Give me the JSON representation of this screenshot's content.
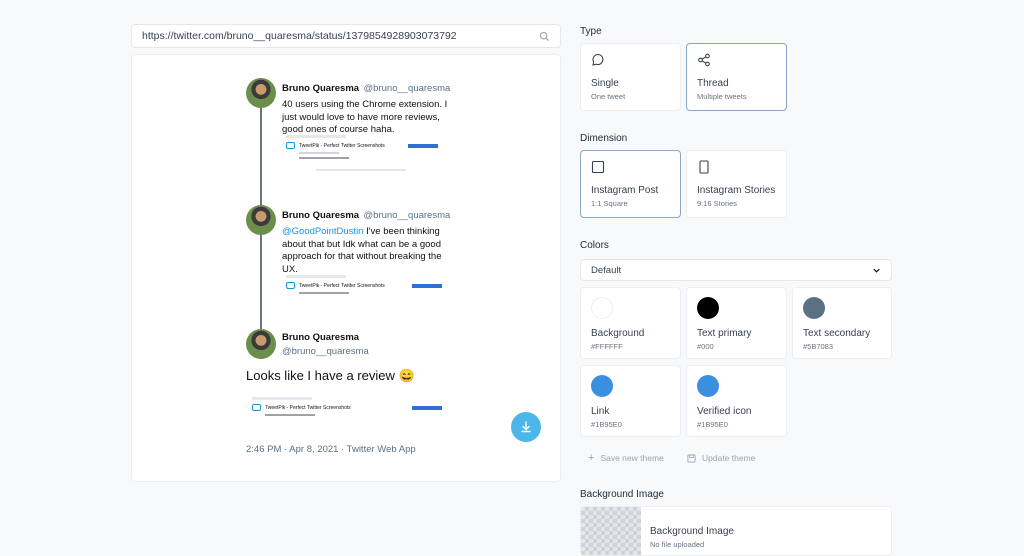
{
  "url_bar": {
    "value": "https://twitter.com/bruno__quaresma/status/1379854928903073792"
  },
  "tweets": [
    {
      "name": "Bruno Quaresma",
      "handle": "@bruno__quaresma",
      "body": "40 users using the Chrome extension. I just would love to have more reviews, good ones of course haha.",
      "mini_title": "TweetPik - Perfect Twitter Screenshots"
    },
    {
      "name": "Bruno Quaresma",
      "handle": "@bruno__quaresma",
      "mention": "@GoodPointDustin",
      "body": " I've been thinking about that but Idk what can be a good approach for that without breaking the UX.",
      "mini_title": "TweetPik - Perfect Twitter Screenshots"
    },
    {
      "name": "Bruno Quaresma",
      "handle": "@bruno__quaresma",
      "body": "Looks like I have a review 😄",
      "mini_title": "TweetPik - Perfect Twitter Screenshots",
      "meta": "2:46 PM · Apr 8, 2021 · Twitter Web App"
    }
  ],
  "type": {
    "label": "Type",
    "options": [
      {
        "label": "Single",
        "sub": "One tweet",
        "icon": "chat-bubble-icon"
      },
      {
        "label": "Thread",
        "sub": "Multiple tweets",
        "icon": "share-nodes-icon",
        "selected": true
      }
    ]
  },
  "dimension": {
    "label": "Dimension",
    "options": [
      {
        "label": "Instagram Post",
        "sub": "1:1 Square",
        "icon": "square-icon",
        "selected": true
      },
      {
        "label": "Instagram Stories",
        "sub": "9:16 Stories",
        "icon": "portrait-icon"
      }
    ]
  },
  "colors": {
    "label": "Colors",
    "theme_select": "Default",
    "items": [
      {
        "label": "Background",
        "hex": "#FFFFFF"
      },
      {
        "label": "Text primary",
        "hex": "#000"
      },
      {
        "label": "Text secondary",
        "hex": "#5B7083"
      },
      {
        "label": "Link",
        "hex": "#1B95E0"
      },
      {
        "label": "Verified icon",
        "hex": "#1B95E0"
      }
    ],
    "save_label": "Save new theme",
    "update_label": "Update theme"
  },
  "background_image": {
    "section_label": "Background Image",
    "card_label": "Background Image",
    "card_sub": "No file uploaded"
  }
}
